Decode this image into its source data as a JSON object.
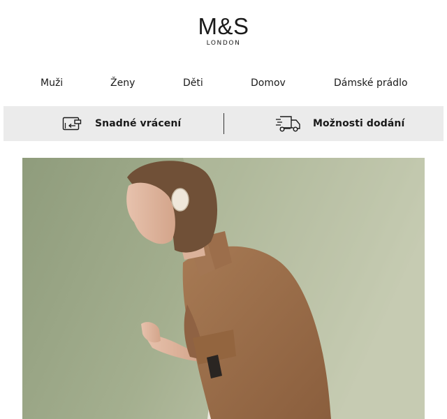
{
  "brand": {
    "name": "M&S",
    "tagline": "LONDON"
  },
  "nav": {
    "items": [
      {
        "label": "Muži"
      },
      {
        "label": "Ženy"
      },
      {
        "label": "Děti"
      },
      {
        "label": "Domov"
      },
      {
        "label": "Dámské prádlo"
      }
    ]
  },
  "services": {
    "returns": {
      "label": "Snadné vrácení",
      "icon": "return-box-icon"
    },
    "delivery": {
      "label": "Možnosti dodání",
      "icon": "delivery-truck-icon"
    }
  },
  "hero": {
    "image": "woman-in-brown-shirt-photo",
    "colors": {
      "background": "#a3af8e",
      "shirt": "#9a6b47",
      "hair": "#6e4e34"
    }
  }
}
